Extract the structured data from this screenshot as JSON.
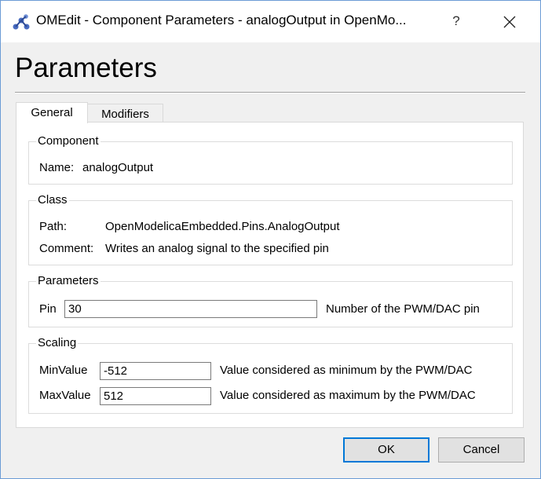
{
  "window": {
    "title": "OMEdit - Component Parameters - analogOutput in OpenMo...",
    "help_label": "?"
  },
  "heading": "Parameters",
  "tabs": [
    {
      "label": "General",
      "active": true
    },
    {
      "label": "Modifiers",
      "active": false
    }
  ],
  "component_group": {
    "title": "Component",
    "name_label": "Name:",
    "name_value": "analogOutput"
  },
  "class_group": {
    "title": "Class",
    "path_label": "Path:",
    "path_value": "OpenModelicaEmbedded.Pins.AnalogOutput",
    "comment_label": "Comment:",
    "comment_value": "Writes an analog signal to the specified pin"
  },
  "parameters_group": {
    "title": "Parameters",
    "pin_label": "Pin",
    "pin_value": "30",
    "pin_description": "Number of the PWM/DAC pin"
  },
  "scaling_group": {
    "title": "Scaling",
    "min_label": "MinValue",
    "min_value": "-512",
    "min_description": "Value considered as minimum by the PWM/DAC",
    "max_label": "MaxValue",
    "max_value": "512",
    "max_description": "Value considered as maximum by the PWM/DAC"
  },
  "buttons": {
    "ok": "OK",
    "cancel": "Cancel"
  },
  "colors": {
    "accent": "#0078d7",
    "icon": "#4a6cc0"
  },
  "icons": {
    "app": "openmodelica-app-icon",
    "close": "close-icon"
  }
}
